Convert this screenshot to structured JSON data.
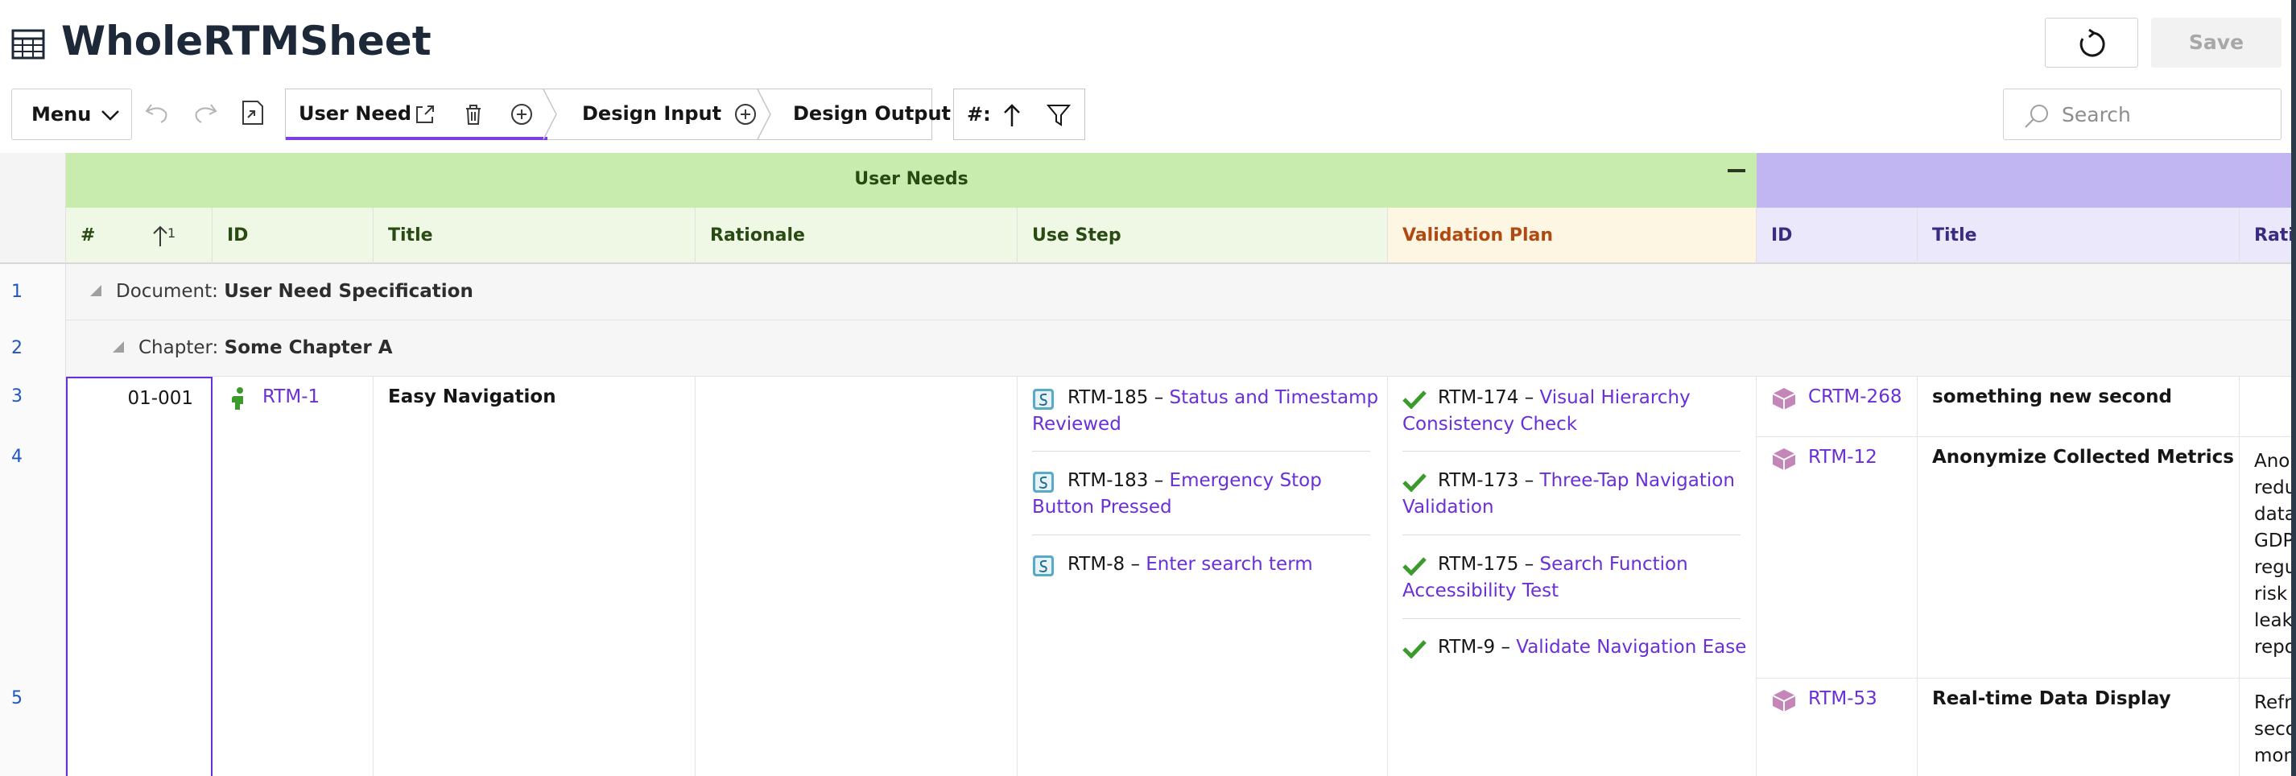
{
  "page": {
    "title": "WholeRTMSheet",
    "save_label": "Save"
  },
  "toolbar": {
    "menu_label": "Menu",
    "wizard": [
      {
        "label": "User Need"
      },
      {
        "label": "Design Input"
      },
      {
        "label": "Design Output"
      }
    ],
    "sort_label": "#:",
    "search_placeholder": "Search"
  },
  "grid": {
    "groups": [
      {
        "label": "User Needs",
        "color": "#c8ecae"
      },
      {
        "label": "",
        "color": "#c1b6f2"
      }
    ],
    "columns": [
      {
        "label": "#",
        "sort_index": "1"
      },
      {
        "label": "ID"
      },
      {
        "label": "Title"
      },
      {
        "label": "Rationale"
      },
      {
        "label": "Use Step"
      },
      {
        "label": "Validation Plan"
      },
      {
        "label": "ID"
      },
      {
        "label": "Title"
      },
      {
        "label": "Ratio"
      }
    ],
    "row_numbers": [
      "1",
      "2",
      "3",
      "4",
      "5"
    ],
    "document_row": {
      "prefix": "Document:",
      "name": "User Need Specification"
    },
    "chapter_row": {
      "prefix": "Chapter:",
      "name": "Some Chapter A"
    },
    "need": {
      "number": "01-001",
      "id": "RTM-1",
      "title": "Easy Navigation",
      "use_steps": [
        {
          "id": "RTM-185 –",
          "link_line1": "Status and Timestamp",
          "link_line2": "Reviewed"
        },
        {
          "id": "RTM-183 –",
          "link_line1": "Emergency Stop",
          "link_line2": "Button Pressed"
        },
        {
          "id": "RTM-8 –",
          "link_line1": "Enter search term",
          "link_line2": ""
        }
      ],
      "validation_plans": [
        {
          "id": "RTM-174 –",
          "link_line1": "Visual Hierarchy",
          "link_line2": "Consistency Check"
        },
        {
          "id": "RTM-173 –",
          "link_line1": "Three-Tap Navigation",
          "link_line2": "Validation"
        },
        {
          "id": "RTM-175 –",
          "link_line1": "Search Function",
          "link_line2": "Accessibility Test"
        },
        {
          "id": "RTM-9 –",
          "link_line1": "Validate Navigation Ease",
          "link_line2": ""
        }
      ]
    },
    "design_inputs": [
      {
        "id": "CRTM-268",
        "title": "something new second",
        "rationale": []
      },
      {
        "id": "RTM-12",
        "title": "Anonymize Collected Metrics",
        "rationale": [
          "Anon",
          "redu",
          "data",
          "GDP",
          "regu",
          "risk",
          "leak",
          "repo"
        ]
      },
      {
        "id": "RTM-53",
        "title": "Real-time Data Display",
        "rationale": [
          "Refr",
          "seco",
          "mon"
        ]
      }
    ]
  }
}
